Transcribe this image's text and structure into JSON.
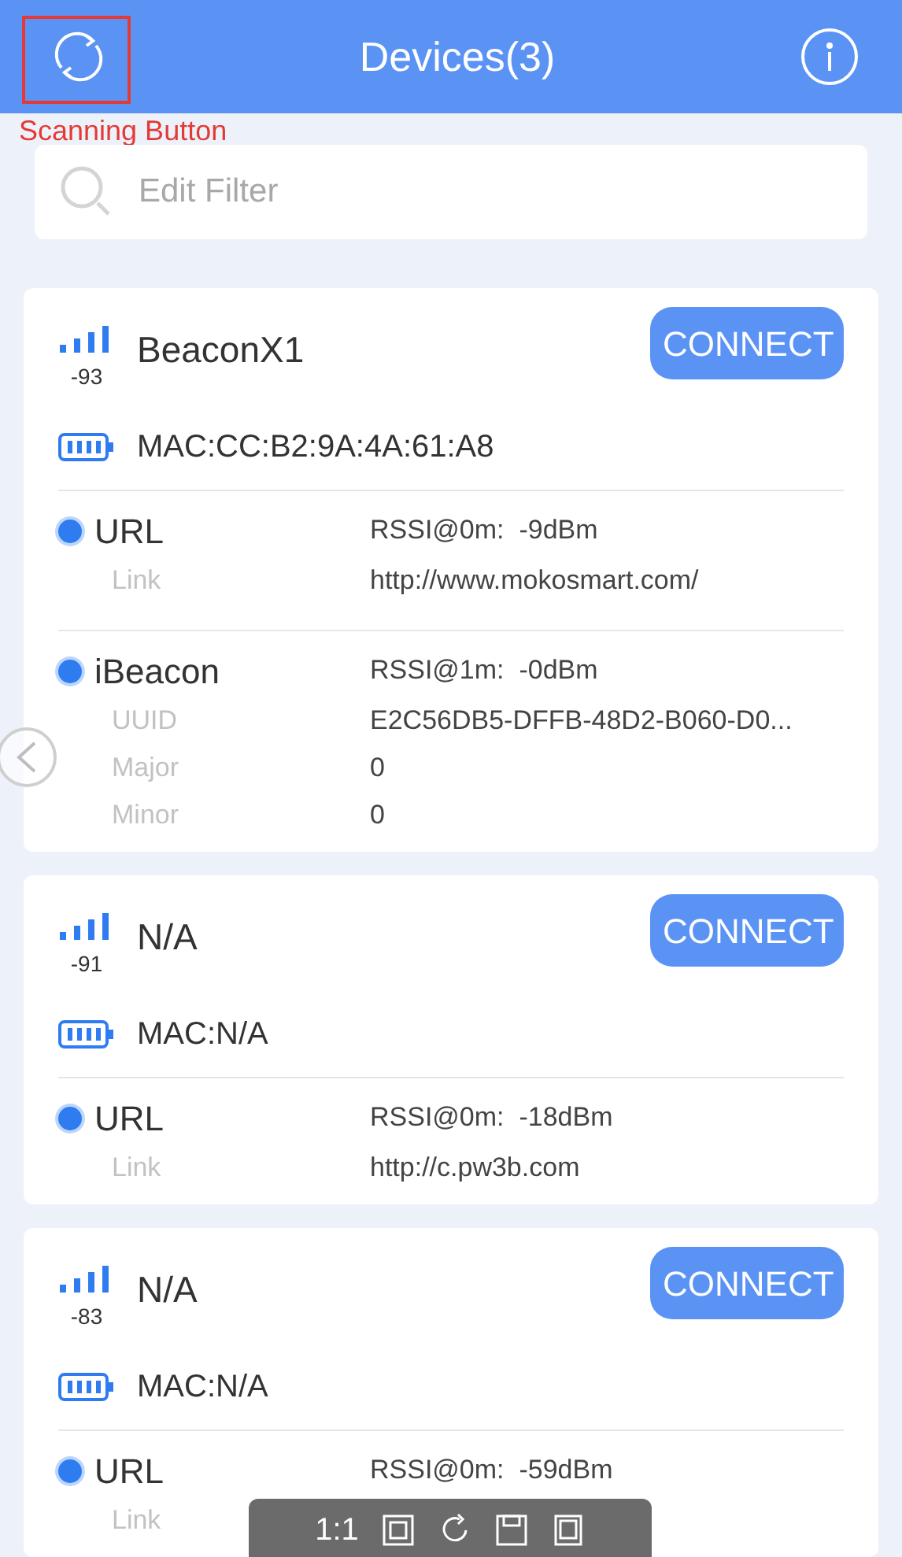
{
  "header": {
    "title": "Devices(3)"
  },
  "annotation": {
    "label": "Scanning Button"
  },
  "filter": {
    "placeholder": "Edit Filter"
  },
  "devices": [
    {
      "rssi": "-93",
      "name": "BeaconX1",
      "mac": "MAC:CC:B2:9A:4A:61:A8",
      "button": "CONNECT",
      "frames": [
        {
          "type": "URL",
          "reading": "RSSI@0m:  -9dBm",
          "fields": [
            {
              "label": "Link",
              "value": "http://www.mokosmart.com/"
            }
          ]
        },
        {
          "type": "iBeacon",
          "reading": "RSSI@1m:  -0dBm",
          "fields": [
            {
              "label": "UUID",
              "value": "E2C56DB5-DFFB-48D2-B060-D0..."
            },
            {
              "label": "Major",
              "value": "0"
            },
            {
              "label": "Minor",
              "value": "0"
            }
          ]
        }
      ]
    },
    {
      "rssi": "-91",
      "name": "N/A",
      "mac": "MAC:N/A",
      "button": "CONNECT",
      "frames": [
        {
          "type": "URL",
          "reading": "RSSI@0m:  -18dBm",
          "fields": [
            {
              "label": "Link",
              "value": "http://c.pw3b.com"
            }
          ]
        }
      ]
    },
    {
      "rssi": "-83",
      "name": "N/A",
      "mac": "MAC:N/A",
      "button": "CONNECT",
      "frames": [
        {
          "type": "URL",
          "reading": "RSSI@0m:  -59dBm",
          "fields": [
            {
              "label": "Link"
            }
          ]
        }
      ]
    }
  ],
  "viewer_toolbar": {
    "zoom_label": "1:1"
  }
}
